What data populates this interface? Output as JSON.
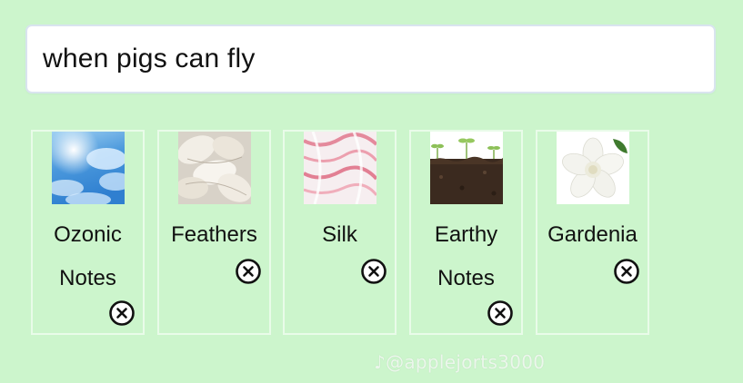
{
  "search": {
    "value": "when pigs can fly"
  },
  "scent_notes": [
    {
      "label": "Ozonic Notes",
      "image": "blue-sky-clouds",
      "remove_icon": "close-circle-icon"
    },
    {
      "label": "Feathers",
      "image": "white-feathers",
      "remove_icon": "close-circle-icon"
    },
    {
      "label": "Silk",
      "image": "pink-white-silk",
      "remove_icon": "close-circle-icon"
    },
    {
      "label": "Earthy Notes",
      "image": "soil-sprouts",
      "remove_icon": "close-circle-icon"
    },
    {
      "label": "Gardenia",
      "image": "white-gardenia-flower",
      "remove_icon": "close-circle-icon"
    }
  ],
  "watermark": {
    "text": "@applejorts3000",
    "icon": "tiktok-logo-icon"
  },
  "colors": {
    "background": "#ccf5cc",
    "card_border": "#e9fbe9",
    "input_background": "#ffffff",
    "text": "#111111"
  }
}
